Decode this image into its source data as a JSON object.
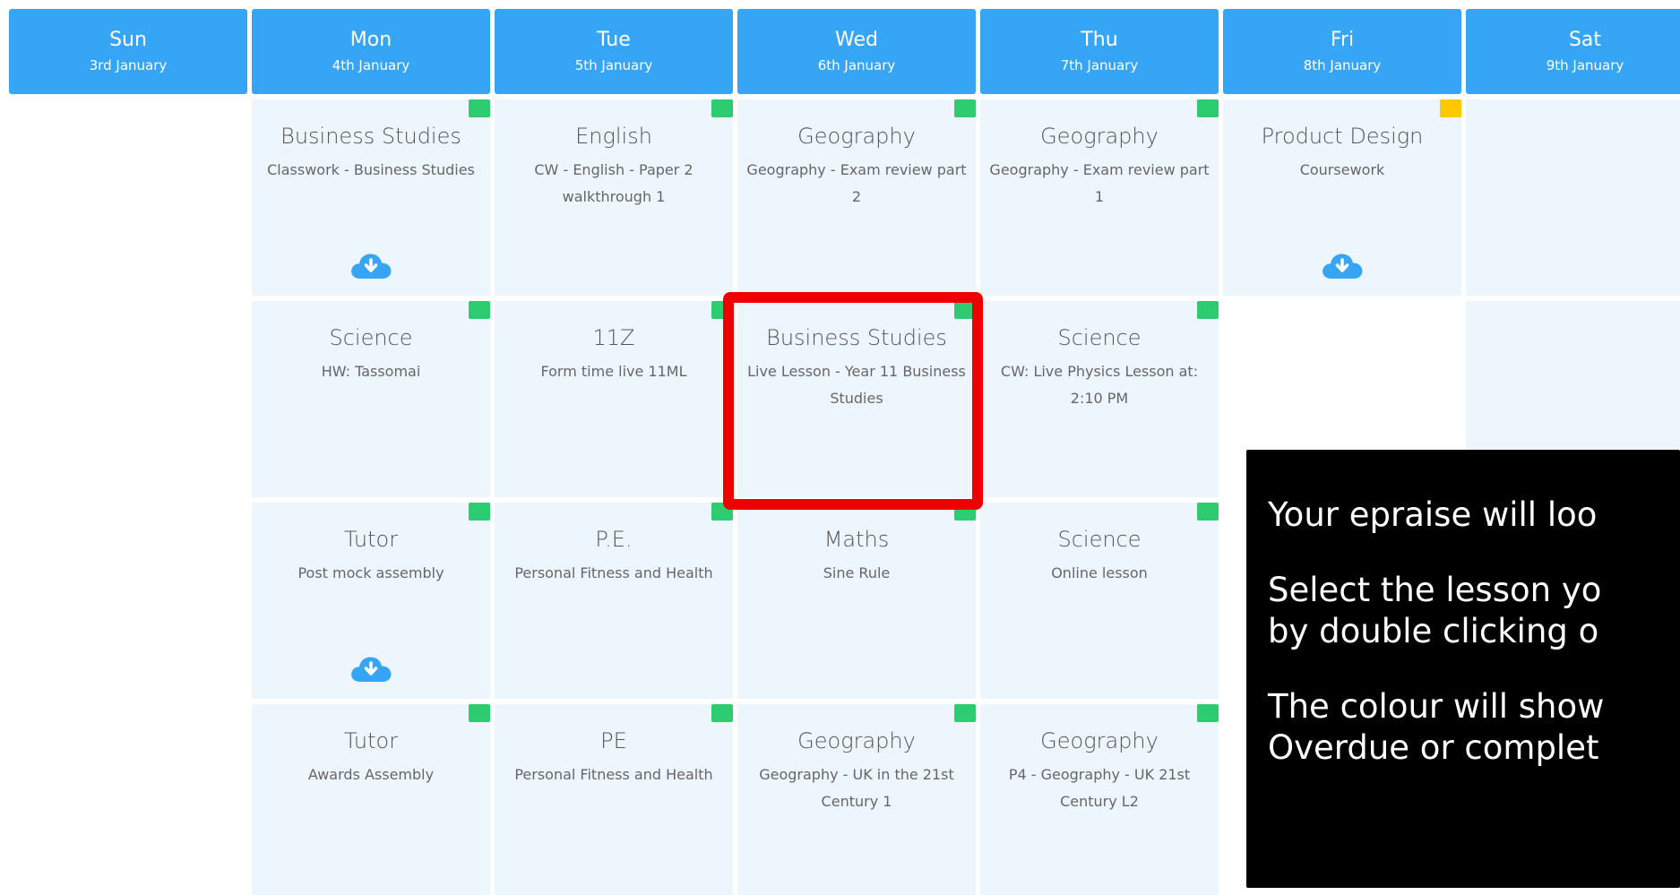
{
  "colors": {
    "header_blue": "#36a5f5",
    "cell_bg": "#eef6fd",
    "status_green": "#2ecc71",
    "status_amber": "#ffc800",
    "download_icon": "#36a5f5",
    "highlight": "#ee0000"
  },
  "days": [
    {
      "name": "Sun",
      "date": "3rd January"
    },
    {
      "name": "Mon",
      "date": "4th January"
    },
    {
      "name": "Tue",
      "date": "5th January"
    },
    {
      "name": "Wed",
      "date": "6th January"
    },
    {
      "name": "Thu",
      "date": "7th January"
    },
    {
      "name": "Fri",
      "date": "8th January"
    },
    {
      "name": "Sat",
      "date": "9th January"
    }
  ],
  "rows": [
    [
      null,
      {
        "subject": "Business Studies",
        "title": "Classwork - Business Studies",
        "status": "green",
        "download": true
      },
      {
        "subject": "English",
        "title": "CW - English - Paper 2 walkthrough 1",
        "status": "green",
        "download": false
      },
      {
        "subject": "Geography",
        "title": "Geography - Exam review part 2",
        "status": "green",
        "download": false
      },
      {
        "subject": "Geography",
        "title": "Geography - Exam review part 1",
        "status": "green",
        "download": false
      },
      {
        "subject": "Product Design",
        "title": "Coursework",
        "status": "amber",
        "download": true
      },
      {
        "empty_filled": true
      }
    ],
    [
      null,
      {
        "subject": "Science",
        "title": "HW: Tassomai",
        "status": "green",
        "download": false
      },
      {
        "subject": "11Z",
        "title": "Form time live 11ML",
        "status": "green",
        "download": false
      },
      {
        "subject": "Business Studies",
        "title": "Live Lesson - Year 11 Business Studies",
        "status": "green",
        "download": false
      },
      {
        "subject": "Science",
        "title": "CW: Live Physics Lesson at: 2:10 PM",
        "status": "green",
        "download": false
      },
      null,
      {
        "empty_filled": true
      }
    ],
    [
      null,
      {
        "subject": "Tutor",
        "title": "Post mock assembly",
        "status": "green",
        "download": true
      },
      {
        "subject": "P.E.",
        "title": "Personal Fitness and Health",
        "status": "green",
        "download": false
      },
      {
        "subject": "Maths",
        "title": "Sine Rule",
        "status": "green",
        "download": false
      },
      {
        "subject": "Science",
        "title": "Online lesson",
        "status": "green",
        "download": false
      },
      null,
      null
    ],
    [
      null,
      {
        "subject": "Tutor",
        "title": "Awards Assembly",
        "status": "green",
        "download": false
      },
      {
        "subject": "PE",
        "title": "Personal Fitness and Health",
        "status": "green",
        "download": false
      },
      {
        "subject": "Geography",
        "title": "Geography - UK in the 21st Century 1",
        "status": "green",
        "download": false
      },
      {
        "subject": "Geography",
        "title": "P4 - Geography - UK 21st Century L2",
        "status": "green",
        "download": false
      },
      null,
      null
    ]
  ],
  "tooltip": {
    "line1": "Your epraise will loo",
    "line2": "Select the lesson yo",
    "line3": "by double clicking o",
    "line4": "The colour will show",
    "line5": "Overdue or complet"
  }
}
